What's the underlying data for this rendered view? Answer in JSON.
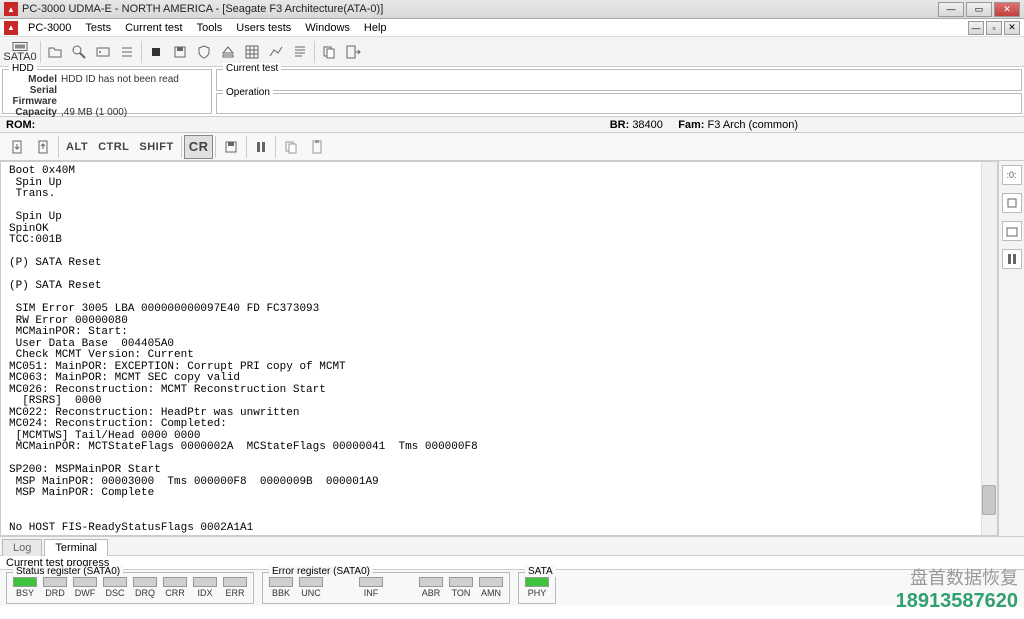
{
  "window": {
    "title": "PC-3000 UDMA-E - NORTH AMERICA - [Seagate F3 Architecture(ATA-0)]"
  },
  "menu": {
    "items": [
      "PC-3000",
      "Tests",
      "Current test",
      "Tools",
      "Users tests",
      "Windows",
      "Help"
    ]
  },
  "toolbar": {
    "sata_label": "SATA0"
  },
  "hdd": {
    "legend": "HDD",
    "model_label": "Model",
    "model_value": "HDD ID has not been read",
    "serial_label": "Serial",
    "serial_value": "",
    "firmware_label": "Firmware",
    "firmware_value": "",
    "capacity_label": "Capacity",
    "capacity_value": ",49 MB (1 000)"
  },
  "current_test": {
    "legend": "Current test",
    "value": ""
  },
  "operation": {
    "legend": "Operation",
    "value": ""
  },
  "rom": {
    "label": "ROM:",
    "br_label": "BR:",
    "br_value": "38400",
    "fam_label": "Fam:",
    "fam_value": "F3 Arch (common)"
  },
  "toolbar2": {
    "alt": "ALT",
    "ctrl": "CTRL",
    "shift": "SHIFT",
    "cr": "CR"
  },
  "terminal_text": "Boot 0x40M\n Spin Up\n Trans.\n\n Spin Up\nSpinOK\nTCC:001B\n\n(P) SATA Reset\n\n(P) SATA Reset\n\n SIM Error 3005 LBA 000000000097E40 FD FC373093\n RW Error 00000080\n MCMainPOR: Start:\n User Data Base  004405A0\n Check MCMT Version: Current\nMC051: MainPOR: EXCEPTION: Corrupt PRI copy of MCMT\nMC063: MainPOR: MCMT SEC copy valid\nMC026: Reconstruction: MCMT Reconstruction Start\n  [RSRS]  0000\nMC022: Reconstruction: HeadPtr was unwritten\nMC024: Reconstruction: Completed:\n [MCMTWS] Tail/Head 0000 0000\n MCMainPOR: MCTStateFlags 0000002A  MCStateFlags 00000041  Tms 000000F8\n\nSP200: MSPMainPOR Start\n MSP MainPOR: 00003000  Tms 000000F8  0000009B  000001A9\n MSP MainPOR: Complete\n\n\nNo HOST FIS-ReadyStatusFlags 0002A1A1",
  "tabs": {
    "log": "Log",
    "terminal": "Terminal"
  },
  "progress": {
    "label": "Current test progress"
  },
  "status_reg": {
    "legend": "Status register (SATA0)",
    "bits": [
      {
        "label": "BSY",
        "on": true
      },
      {
        "label": "DRD",
        "on": false
      },
      {
        "label": "DWF",
        "on": false
      },
      {
        "label": "DSC",
        "on": false
      },
      {
        "label": "DRQ",
        "on": false
      },
      {
        "label": "CRR",
        "on": false
      },
      {
        "label": "IDX",
        "on": false
      },
      {
        "label": "ERR",
        "on": false
      }
    ]
  },
  "error_reg": {
    "legend": "Error register (SATA0)",
    "bits": [
      {
        "label": "BBK",
        "on": false
      },
      {
        "label": "UNC",
        "on": false
      },
      {
        "label": "",
        "on": false
      },
      {
        "label": "INF",
        "on": false
      },
      {
        "label": "",
        "on": false
      },
      {
        "label": "ABR",
        "on": false
      },
      {
        "label": "TON",
        "on": false
      },
      {
        "label": "AMN",
        "on": false
      }
    ]
  },
  "sata_reg": {
    "legend": "SATA",
    "bits": [
      {
        "label": "PHY",
        "on": true
      }
    ]
  },
  "watermark": {
    "cn": "盘首数据恢复",
    "num": "18913587620"
  }
}
